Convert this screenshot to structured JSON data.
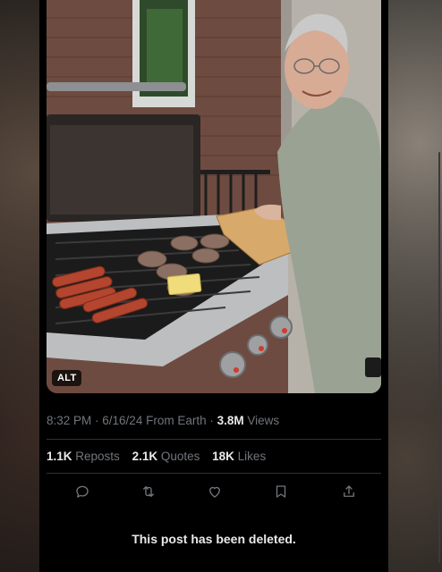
{
  "photo": {
    "alt_badge": "ALT",
    "icon": "bbq-grill-photo"
  },
  "meta": {
    "time": "8:32 PM",
    "sep1": " · ",
    "date": "6/16/24",
    "source": " From Earth",
    "sep2": " · ",
    "views_count": "3.8M",
    "views_label": " Views"
  },
  "stats": {
    "reposts_count": "1.1K",
    "reposts_label": " Reposts",
    "quotes_count": "2.1K",
    "quotes_label": " Quotes",
    "likes_count": "18K",
    "likes_label": " Likes"
  },
  "actions": [
    {
      "name": "reply",
      "icon": "reply-icon"
    },
    {
      "name": "repost",
      "icon": "repost-icon"
    },
    {
      "name": "like",
      "icon": "heart-icon"
    },
    {
      "name": "bookmark",
      "icon": "bookmark-icon"
    },
    {
      "name": "share",
      "icon": "share-icon"
    }
  ],
  "notice": "This post has been deleted.",
  "colors": {
    "background": "#000000",
    "muted_text": "#71767b",
    "primary_text": "#e7e9ea",
    "divider": "#2f3336"
  }
}
